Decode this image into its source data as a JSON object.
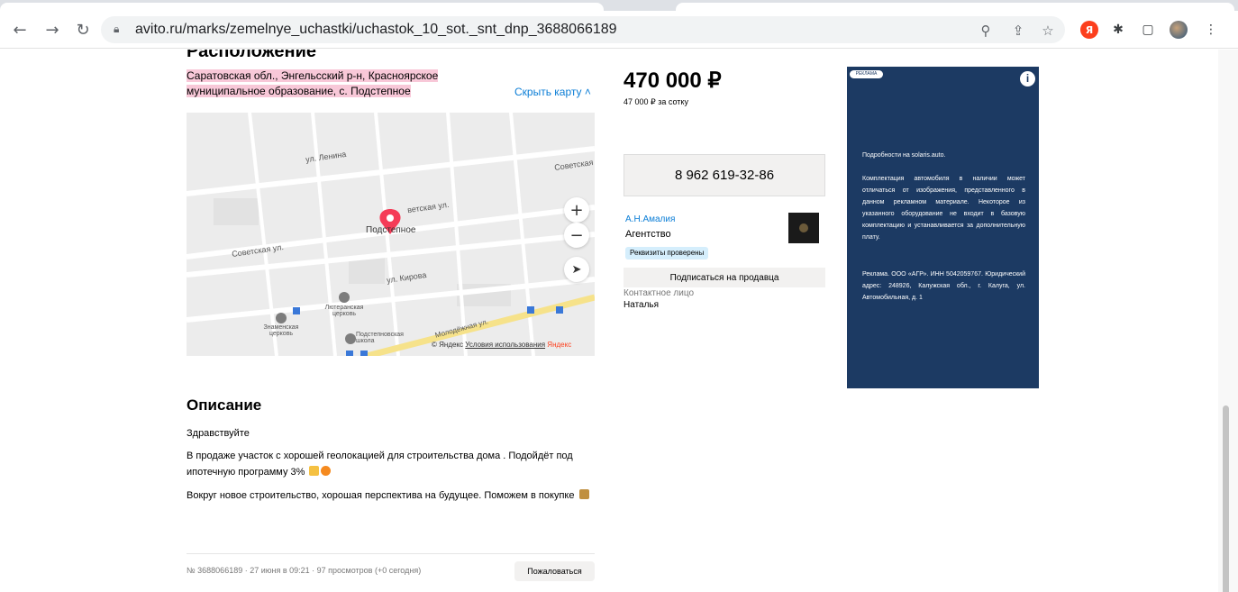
{
  "browser": {
    "url": "avito.ru/marks/zemelnye_uchastki/uchastok_10_sot._snt_dnp_3688066189",
    "extensions": [
      "zoom-icon",
      "share-icon",
      "bookmark-star-icon",
      "yandex-icon",
      "puzzle-icon",
      "sidepanel-icon",
      "profile-avatar",
      "menu-dots-icon"
    ]
  },
  "listing": {
    "section_title_cut": "Расположение",
    "address": "Саратовская обл., Энгельсский р-н, Красноярское муниципальное образование, с. Подстепное",
    "hide_map": "Скрыть карту ˄",
    "map": {
      "labels": {
        "lenina": "ул. Ленина",
        "sovetskaya_right": "Советская ул.",
        "sovetskaya_left": "Советская ул.",
        "street_mid": "ветская ул.",
        "town": "Подстепное",
        "kirova": "ул. Кирова",
        "lutheran": "Лютеранская церковь",
        "znamenskaya": "Знаменская церковь",
        "school": "Подстепновская школа",
        "molodezh": "Молодёжная ул."
      },
      "footer_copy": "© Яндекс",
      "footer_terms": "Условия использования",
      "footer_brand": "Яндекс"
    },
    "description": {
      "title": "Описание",
      "lines": [
        "Здравствуйте",
        "В продаже участок с хорошей геолокацией для строительства дома . Подойдёт под ипотечную программу 3%",
        "Вокруг новое строительство, хорошая перспектива на будущее. Поможем в покупке"
      ]
    },
    "meta": "№ 3688066189 · 27 июня в 09:21 · 97 просмотров (+0 сегодня)",
    "report_button": "Пожаловаться"
  },
  "seller": {
    "price": "470 000 ₽",
    "price_per": "47 000 ₽ за сотку",
    "phone": "8 962 619-32-86",
    "name": "А.Н.Амалия",
    "type": "Агентство",
    "verified": "Реквизиты проверены",
    "subscribe": "Подписаться на продавца",
    "contact_label": "Контактное лицо",
    "contact_name": "Наталья"
  },
  "ad": {
    "badge": "РЕКЛАМА",
    "info": "i",
    "heading": "Подробности на solaris.auto.",
    "body": "Комплектация автомобиля в наличии может отличаться от изображения, представленного в данном рекламном материале. Некоторое из указанного оборудование не входит в базовую комплектацию и устанавливается за дополнительную плату.",
    "legal": "Реклама. ООО «АГР». ИНН 5042059767. Юридический адрес: 248926, Калужская обл., г. Калуга, ул. Автомобильная, д. 1"
  },
  "colors": {
    "link": "#0a7dd6",
    "address_highlight": "#f8c8d8",
    "ad_bg": "#1c3a63",
    "pin": "#f53b57"
  }
}
